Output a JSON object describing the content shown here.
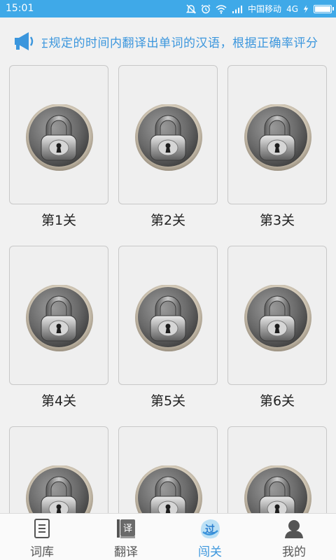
{
  "status_bar": {
    "time": "15:01",
    "carrier": "中国移动",
    "network": "4G",
    "icons": [
      "alarm-off-icon",
      "alarm-clock-icon",
      "wifi-icon",
      "signal-icon",
      "charging-icon",
      "battery-icon"
    ]
  },
  "marquee": {
    "icon": "megaphone-icon",
    "text": "在规定的时间内翻译出单词的汉语，根据正确率评分"
  },
  "levels": [
    {
      "label": "第1关",
      "locked": true
    },
    {
      "label": "第2关",
      "locked": true
    },
    {
      "label": "第3关",
      "locked": true
    },
    {
      "label": "第4关",
      "locked": true
    },
    {
      "label": "第5关",
      "locked": true
    },
    {
      "label": "第6关",
      "locked": true
    },
    {
      "label": "",
      "locked": true
    },
    {
      "label": "",
      "locked": true
    },
    {
      "label": "",
      "locked": true
    }
  ],
  "bottom_nav": {
    "active": "闯关",
    "tabs": [
      {
        "label": "词库",
        "icon": "book-icon"
      },
      {
        "label": "翻译",
        "icon": "translate-icon"
      },
      {
        "label": "闯关",
        "icon": "challenge-icon"
      },
      {
        "label": "我的",
        "icon": "user-icon"
      }
    ]
  },
  "colors": {
    "accent": "#3b96dd",
    "status_bar": "#3fa9e8",
    "background": "#f1f1f1"
  }
}
